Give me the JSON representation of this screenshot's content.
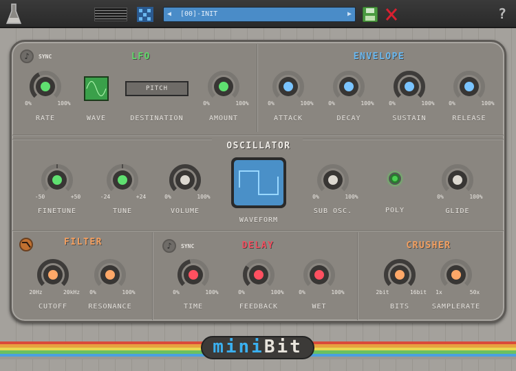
{
  "topbar": {
    "preset_name": "[00]-INIT",
    "help": "?",
    "icons": [
      "flask-logo-icon",
      "preset-list-icon",
      "randomize-icon",
      "prev-preset-icon",
      "next-preset-icon",
      "save-icon",
      "close-icon",
      "help-icon"
    ]
  },
  "lfo": {
    "title": "LFO",
    "sync": "SYNC",
    "wave_label": "WAVE",
    "destination_label": "DESTINATION",
    "destination_value": "PITCH",
    "color": "#5fdc6a"
  },
  "envelope": {
    "title": "ENVELOPE",
    "color": "#6ab8f0"
  },
  "oscillator": {
    "title": "OSCILLATOR",
    "waveform_label": "WAVEFORM",
    "poly_label": "POLY",
    "waveform": "square"
  },
  "filter": {
    "title": "FILTER",
    "color": "#f5a060"
  },
  "delay": {
    "title": "DELAY",
    "sync": "SYNC",
    "color": "#f05060"
  },
  "crusher": {
    "title": "CRUSHER",
    "color": "#f5a060"
  },
  "knobs": [
    {
      "id": "rate",
      "label": "RATE",
      "min": "0%",
      "max": "100%",
      "value": 0.4,
      "color": "#5fe070"
    },
    {
      "id": "amount",
      "label": "AMOUNT",
      "min": "0%",
      "max": "100%",
      "value": 0,
      "color": "#5fe070"
    },
    {
      "id": "attack",
      "label": "ATTACK",
      "min": "0%",
      "max": "100%",
      "value": 0,
      "color": "#7ac4ff"
    },
    {
      "id": "decay",
      "label": "DECAY",
      "min": "0%",
      "max": "100%",
      "value": 0,
      "color": "#7ac4ff"
    },
    {
      "id": "sustain",
      "label": "SUSTAIN",
      "min": "0%",
      "max": "100%",
      "value": 1,
      "color": "#7ac4ff"
    },
    {
      "id": "release",
      "label": "RELEASE",
      "min": "0%",
      "max": "100%",
      "value": 0,
      "color": "#7ac4ff"
    },
    {
      "id": "finetune",
      "label": "FINETUNE",
      "min": "-50",
      "max": "+50",
      "value": 0.5,
      "color": "#5fe070",
      "center": true
    },
    {
      "id": "tune",
      "label": "TUNE",
      "min": "-24",
      "max": "+24",
      "value": 0.5,
      "color": "#5fe070",
      "center": true
    },
    {
      "id": "volume",
      "label": "VOLUME",
      "min": "0%",
      "max": "100%",
      "value": 1,
      "color": "#dcd8d0"
    },
    {
      "id": "sub",
      "label": "SUB OSC.",
      "min": "0%",
      "max": "100%",
      "value": 0,
      "color": "#dcd8d0"
    },
    {
      "id": "glide",
      "label": "GLIDE",
      "min": "0%",
      "max": "100%",
      "value": 0,
      "color": "#dcd8d0"
    },
    {
      "id": "cutoff",
      "label": "CUTOFF",
      "min": "20Hz",
      "max": "20kHz",
      "value": 1,
      "color": "#ffa868"
    },
    {
      "id": "resonance",
      "label": "RESONANCE",
      "min": "0%",
      "max": "100%",
      "value": 0,
      "color": "#ffa868"
    },
    {
      "id": "time",
      "label": "TIME",
      "min": "0%",
      "max": "100%",
      "value": 0.45,
      "color": "#ff5060"
    },
    {
      "id": "feedback",
      "label": "FEEDBACK",
      "min": "0%",
      "max": "100%",
      "value": 0.3,
      "color": "#ff5060"
    },
    {
      "id": "wet",
      "label": "WET",
      "min": "0%",
      "max": "100%",
      "value": 0,
      "color": "#ff5060"
    },
    {
      "id": "bits",
      "label": "BITS",
      "min": "2bit",
      "max": "16bit",
      "value": 1,
      "color": "#ffa868"
    },
    {
      "id": "samplerate",
      "label": "SAMPLERATE",
      "min": "1x",
      "max": "50x",
      "value": 0,
      "color": "#ffa868"
    }
  ],
  "logo": {
    "text_a": "mini",
    "text_b": "Bit"
  }
}
